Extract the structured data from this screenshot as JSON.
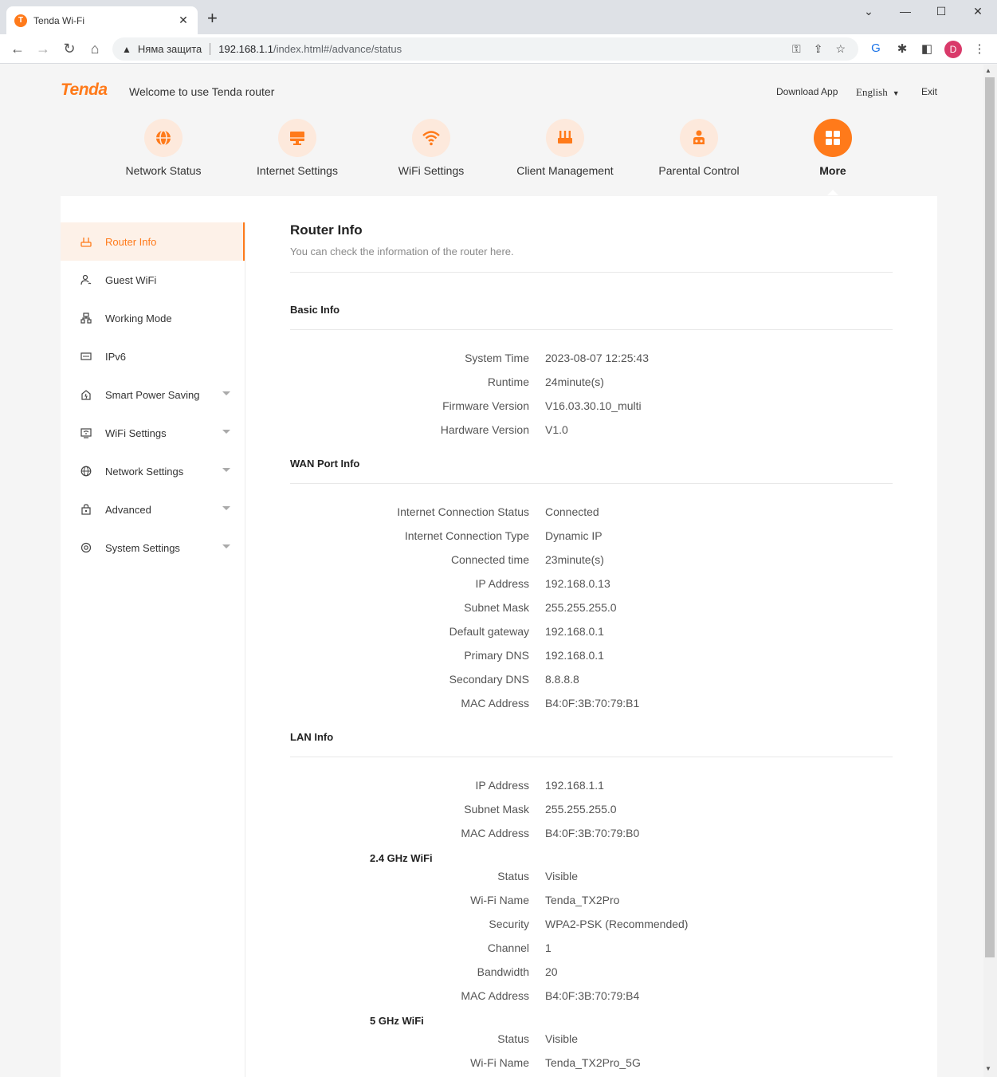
{
  "browser": {
    "tab_title": "Tenda Wi-Fi",
    "tab_close": "✕",
    "new_tab": "+",
    "insecure_label": "Няма защита",
    "url_host": "192.168.1.1",
    "url_path": "/index.html#/advance/status",
    "profile_initial": "D"
  },
  "header": {
    "logo": "Tenda",
    "welcome": "Welcome to use Tenda router",
    "download_app": "Download App",
    "language": "English",
    "exit": "Exit"
  },
  "mainnav": [
    {
      "label": "Network Status"
    },
    {
      "label": "Internet Settings"
    },
    {
      "label": "WiFi Settings"
    },
    {
      "label": "Client Management"
    },
    {
      "label": "Parental Control"
    },
    {
      "label": "More"
    }
  ],
  "sidebar": [
    {
      "label": "Router Info"
    },
    {
      "label": "Guest WiFi"
    },
    {
      "label": "Working Mode"
    },
    {
      "label": "IPv6"
    },
    {
      "label": "Smart Power Saving"
    },
    {
      "label": "WiFi Settings"
    },
    {
      "label": "Network Settings"
    },
    {
      "label": "Advanced"
    },
    {
      "label": "System Settings"
    }
  ],
  "content": {
    "title": "Router Info",
    "subtitle": "You can check the information of the router here.",
    "basic": {
      "title": "Basic Info",
      "rows": [
        {
          "k": "System Time",
          "v": "2023-08-07 12:25:43"
        },
        {
          "k": "Runtime",
          "v": "24minute(s)"
        },
        {
          "k": "Firmware Version",
          "v": "V16.03.30.10_multi"
        },
        {
          "k": "Hardware Version",
          "v": "V1.0"
        }
      ]
    },
    "wan": {
      "title": "WAN Port Info",
      "rows": [
        {
          "k": "Internet Connection Status",
          "v": "Connected"
        },
        {
          "k": "Internet Connection Type",
          "v": "Dynamic IP"
        },
        {
          "k": "Connected time",
          "v": "23minute(s)"
        },
        {
          "k": "IP Address",
          "v": "192.168.0.13"
        },
        {
          "k": "Subnet Mask",
          "v": "255.255.255.0"
        },
        {
          "k": "Default gateway",
          "v": "192.168.0.1"
        },
        {
          "k": "Primary DNS",
          "v": "192.168.0.1"
        },
        {
          "k": "Secondary DNS",
          "v": "8.8.8.8"
        },
        {
          "k": "MAC Address",
          "v": "B4:0F:3B:70:79:B1"
        }
      ]
    },
    "lan": {
      "title": "LAN Info",
      "rows": [
        {
          "k": "IP Address",
          "v": "192.168.1.1"
        },
        {
          "k": "Subnet Mask",
          "v": "255.255.255.0"
        },
        {
          "k": "MAC Address",
          "v": "B4:0F:3B:70:79:B0"
        }
      ]
    },
    "wifi24": {
      "title": "2.4 GHz WiFi",
      "rows": [
        {
          "k": "Status",
          "v": "Visible"
        },
        {
          "k": "Wi-Fi Name",
          "v": "Tenda_TX2Pro"
        },
        {
          "k": "Security",
          "v": "WPA2-PSK (Recommended)"
        },
        {
          "k": "Channel",
          "v": "1"
        },
        {
          "k": "Bandwidth",
          "v": "20"
        },
        {
          "k": "MAC Address",
          "v": "B4:0F:3B:70:79:B4"
        }
      ]
    },
    "wifi5": {
      "title": "5 GHz WiFi",
      "rows": [
        {
          "k": "Status",
          "v": "Visible"
        },
        {
          "k": "Wi-Fi Name",
          "v": "Tenda_TX2Pro_5G"
        }
      ]
    }
  },
  "colors": {
    "accent": "#ff7a1a",
    "accent_light": "#fde9dc"
  }
}
